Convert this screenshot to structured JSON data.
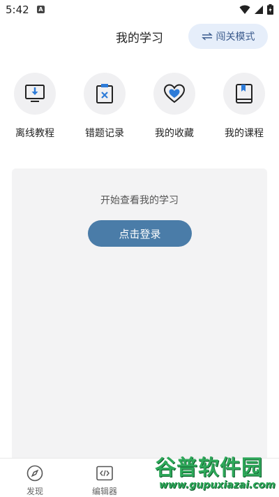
{
  "status_bar": {
    "time": "5:42",
    "notif_badge": "A"
  },
  "header": {
    "title": "我的学习",
    "mode_button_label": "闯关模式"
  },
  "quick_entries": [
    {
      "label": "离线教程",
      "icon": "download-monitor-icon"
    },
    {
      "label": "错题记录",
      "icon": "clipboard-x-icon"
    },
    {
      "label": "我的收藏",
      "icon": "heart-icon"
    },
    {
      "label": "我的课程",
      "icon": "book-icon"
    }
  ],
  "card": {
    "hint": "开始查看我的学习",
    "login_label": "点击登录"
  },
  "bottom_nav": [
    {
      "label": "发现",
      "icon": "compass-icon"
    },
    {
      "label": "编辑器",
      "icon": "code-icon"
    }
  ],
  "watermark": {
    "title": "谷普软件园",
    "url": "www.gupuxiazai.com"
  },
  "colors": {
    "accent": "#4a7ca8",
    "mode_bg": "#e6eefa",
    "icon_blue": "#2d7bd8",
    "card_bg": "#f3f3f4"
  }
}
